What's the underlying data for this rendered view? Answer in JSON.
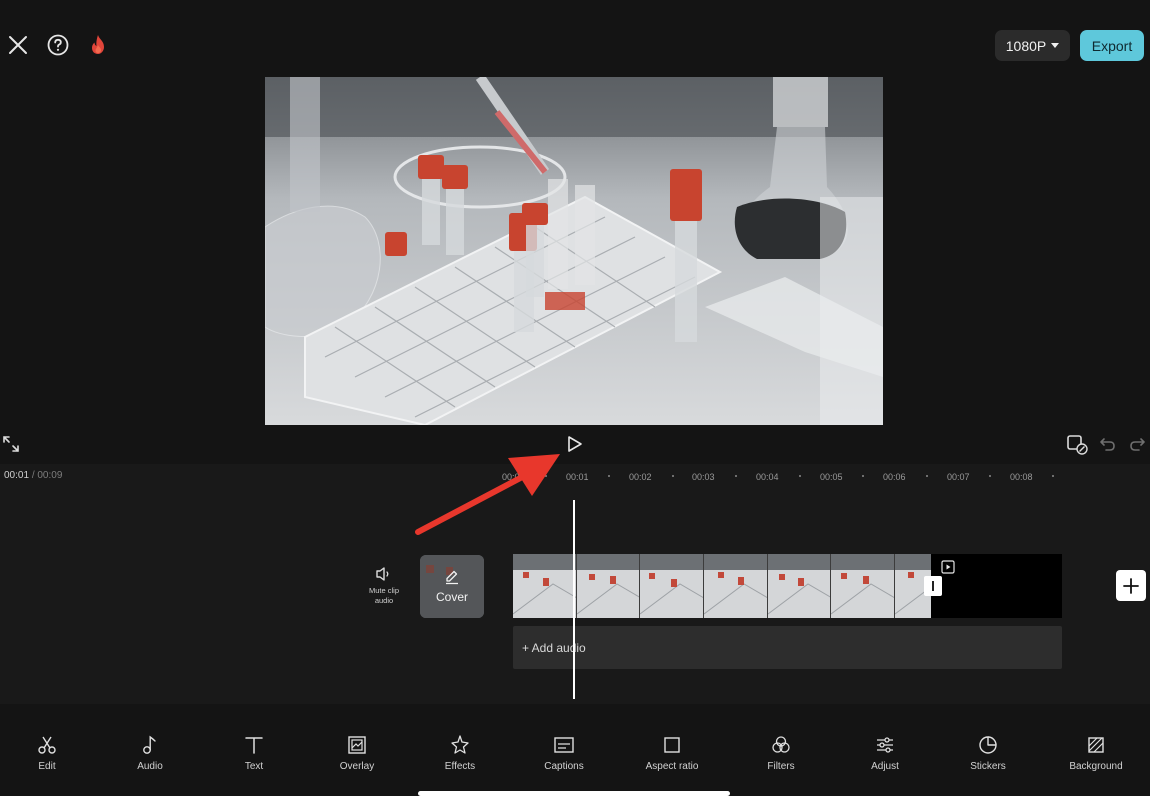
{
  "header": {
    "close_icon": "close-icon",
    "help_icon": "help-icon",
    "trending_icon": "flame-icon",
    "resolution": "1080P",
    "export_label": "Export"
  },
  "playback": {
    "fullscreen_icon": "expand-icon",
    "play_icon": "play-icon",
    "keyframe_icon": "keyframe-icon",
    "undo_icon": "undo-icon",
    "redo_icon": "redo-icon"
  },
  "timeline": {
    "current_time": "00:01",
    "separator": "/",
    "total_time": "00:09",
    "ruler": [
      "00:00",
      "00:01",
      "00:02",
      "00:03",
      "00:04",
      "00:05",
      "00:06",
      "00:07",
      "00:08"
    ],
    "mute_label": "Mute clip audio",
    "cover_label": "Cover",
    "add_audio_label": "+ Add audio"
  },
  "toolbar": [
    {
      "label": "Edit",
      "icon": "scissors-icon"
    },
    {
      "label": "Audio",
      "icon": "music-note-icon"
    },
    {
      "label": "Text",
      "icon": "text-icon"
    },
    {
      "label": "Overlay",
      "icon": "overlay-icon"
    },
    {
      "label": "Effects",
      "icon": "sparkle-icon"
    },
    {
      "label": "Captions",
      "icon": "captions-icon"
    },
    {
      "label": "Aspect ratio",
      "icon": "square-icon"
    },
    {
      "label": "Filters",
      "icon": "filters-icon"
    },
    {
      "label": "Adjust",
      "icon": "sliders-icon"
    },
    {
      "label": "Stickers",
      "icon": "sticker-icon"
    },
    {
      "label": "Background",
      "icon": "background-icon"
    }
  ],
  "colors": {
    "accent": "#5ec8db",
    "background": "#141414",
    "annotation_arrow": "#e8372c"
  }
}
